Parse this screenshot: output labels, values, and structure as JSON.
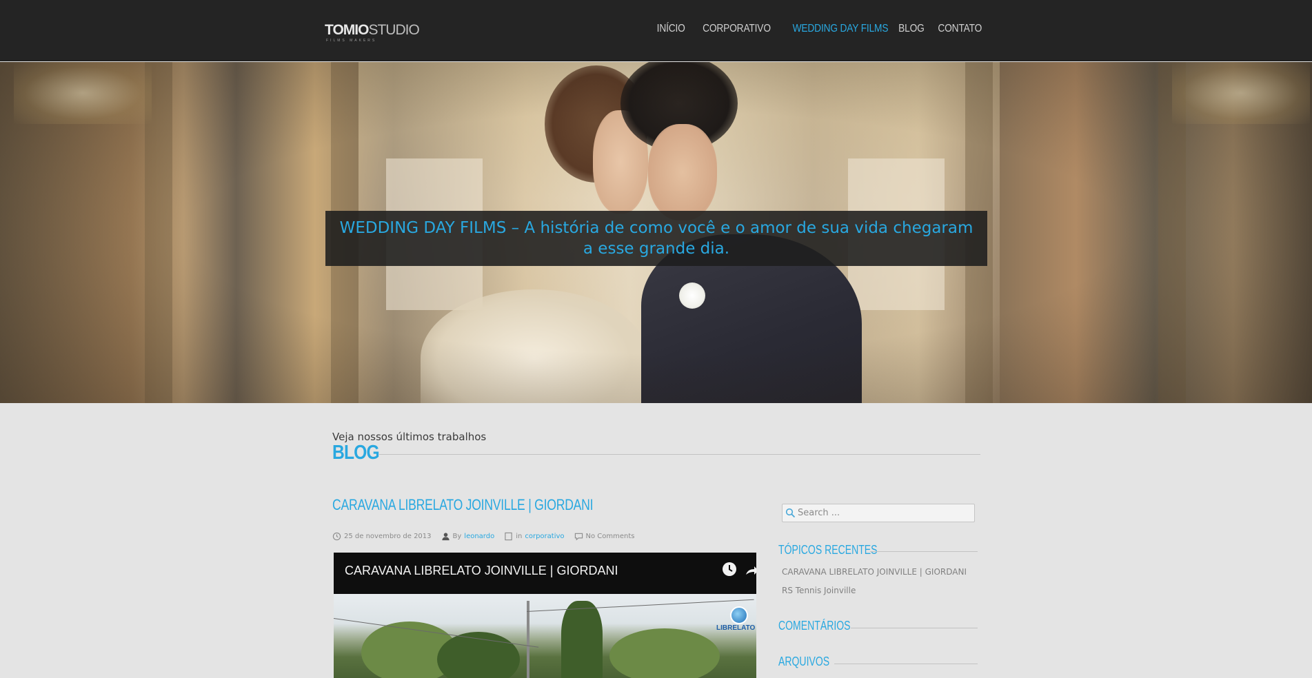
{
  "header": {
    "logo": {
      "bold": "TOMIO",
      "thin": "STUDIO",
      "sub": "FILMS MAKERS"
    },
    "nav": [
      {
        "label": "INÍCIO",
        "active": false
      },
      {
        "label": "CORPORATIVO",
        "active": false
      },
      {
        "label": "WEDDING DAY FILMS",
        "active": true
      },
      {
        "label": "BLOG",
        "active": false
      },
      {
        "label": "CONTATO",
        "active": false
      }
    ]
  },
  "hero": {
    "caption": "WEDDING DAY FILMS – A história de como você e o amor de sua vida chegaram a esse grande dia."
  },
  "section": {
    "tagline": "Veja nossos últimos trabalhos",
    "title": "BLOG"
  },
  "post": {
    "title": "CARAVANA LIBRELATO JOINVILLE | GIORDANI",
    "date": "25 de novembro de 2013",
    "by_prefix": "By",
    "author": "leonardo",
    "in_prefix": "in",
    "category": "corporativo",
    "comments": "No Comments",
    "video": {
      "title": "CARAVANA LIBRELATO JOINVILLE | GIORDANI",
      "logo_text": "LIBRELATO"
    }
  },
  "sidebar": {
    "search_placeholder": "Search ...",
    "recent_heading": "TÓPICOS RECENTES",
    "recent": [
      "CARAVANA LIBRELATO JOINVILLE | GIORDANI",
      "RS Tennis Joinville"
    ],
    "comments_heading": "COMENTÁRIOS",
    "archives_heading": "ARQUIVOS"
  },
  "colors": {
    "accent": "#29a8e0",
    "header_bg": "#242424",
    "body_bg": "#e4e4e4"
  }
}
